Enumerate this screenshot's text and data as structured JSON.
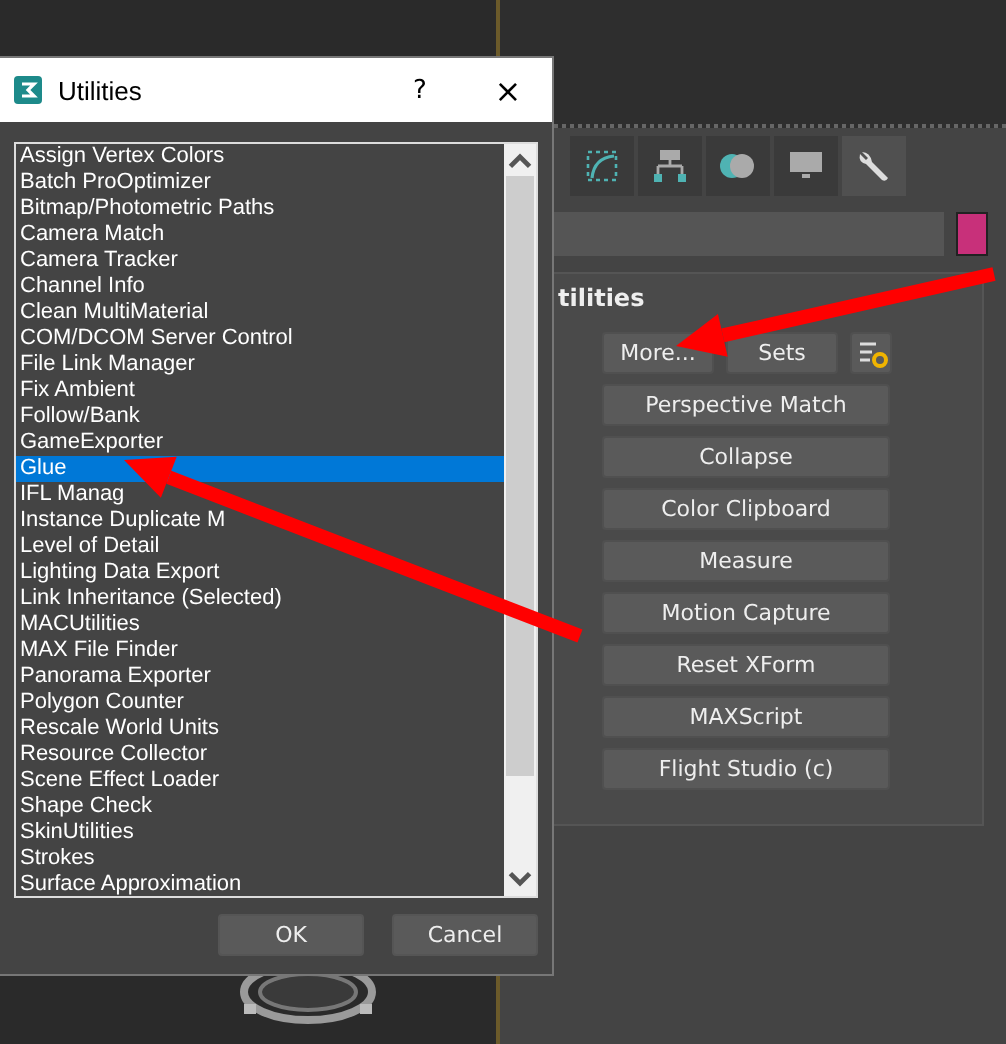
{
  "dialog": {
    "title": "Utilities",
    "help": "?",
    "close": "×",
    "items": [
      {
        "label": "Assign Vertex Colors",
        "selected": false
      },
      {
        "label": "Batch ProOptimizer",
        "selected": false
      },
      {
        "label": "Bitmap/Photometric Paths",
        "selected": false
      },
      {
        "label": "Camera Match",
        "selected": false
      },
      {
        "label": "Camera Tracker",
        "selected": false
      },
      {
        "label": "Channel Info",
        "selected": false
      },
      {
        "label": "Clean MultiMaterial",
        "selected": false
      },
      {
        "label": "COM/DCOM Server Control",
        "selected": false
      },
      {
        "label": "File Link Manager",
        "selected": false
      },
      {
        "label": "Fix Ambient",
        "selected": false
      },
      {
        "label": "Follow/Bank",
        "selected": false
      },
      {
        "label": "GameExporter",
        "selected": false
      },
      {
        "label": "Glue",
        "selected": true
      },
      {
        "label": "IFL Manag",
        "selected": false
      },
      {
        "label": "Instance Duplicate M",
        "selected": false
      },
      {
        "label": "Level of Detail",
        "selected": false
      },
      {
        "label": "Lighting Data Export",
        "selected": false
      },
      {
        "label": "Link Inheritance (Selected)",
        "selected": false
      },
      {
        "label": "MACUtilities",
        "selected": false
      },
      {
        "label": "MAX File Finder",
        "selected": false
      },
      {
        "label": "Panorama Exporter",
        "selected": false
      },
      {
        "label": "Polygon Counter",
        "selected": false
      },
      {
        "label": "Rescale World Units",
        "selected": false
      },
      {
        "label": "Resource Collector",
        "selected": false
      },
      {
        "label": "Scene Effect Loader",
        "selected": false
      },
      {
        "label": "Shape Check",
        "selected": false
      },
      {
        "label": "SkinUtilities",
        "selected": false
      },
      {
        "label": "Strokes",
        "selected": false
      },
      {
        "label": "Surface Approximation",
        "selected": false
      }
    ],
    "buttons": [
      "OK",
      "Cancel"
    ]
  },
  "command_panel": {
    "tabs": [
      {
        "kind": "modify",
        "selected": false
      },
      {
        "kind": "hierarchy",
        "selected": false
      },
      {
        "kind": "motion",
        "selected": false
      },
      {
        "kind": "display",
        "selected": false
      },
      {
        "kind": "utilities",
        "selected": true
      }
    ],
    "rollout": {
      "title": "tilities",
      "top_buttons": [
        "More...",
        "Sets"
      ],
      "buttons": [
        "Perspective Match",
        "Collapse",
        "Color Clipboard",
        "Measure",
        "Motion Capture",
        "Reset XForm",
        "MAXScript",
        "Flight Studio (c)"
      ]
    }
  }
}
